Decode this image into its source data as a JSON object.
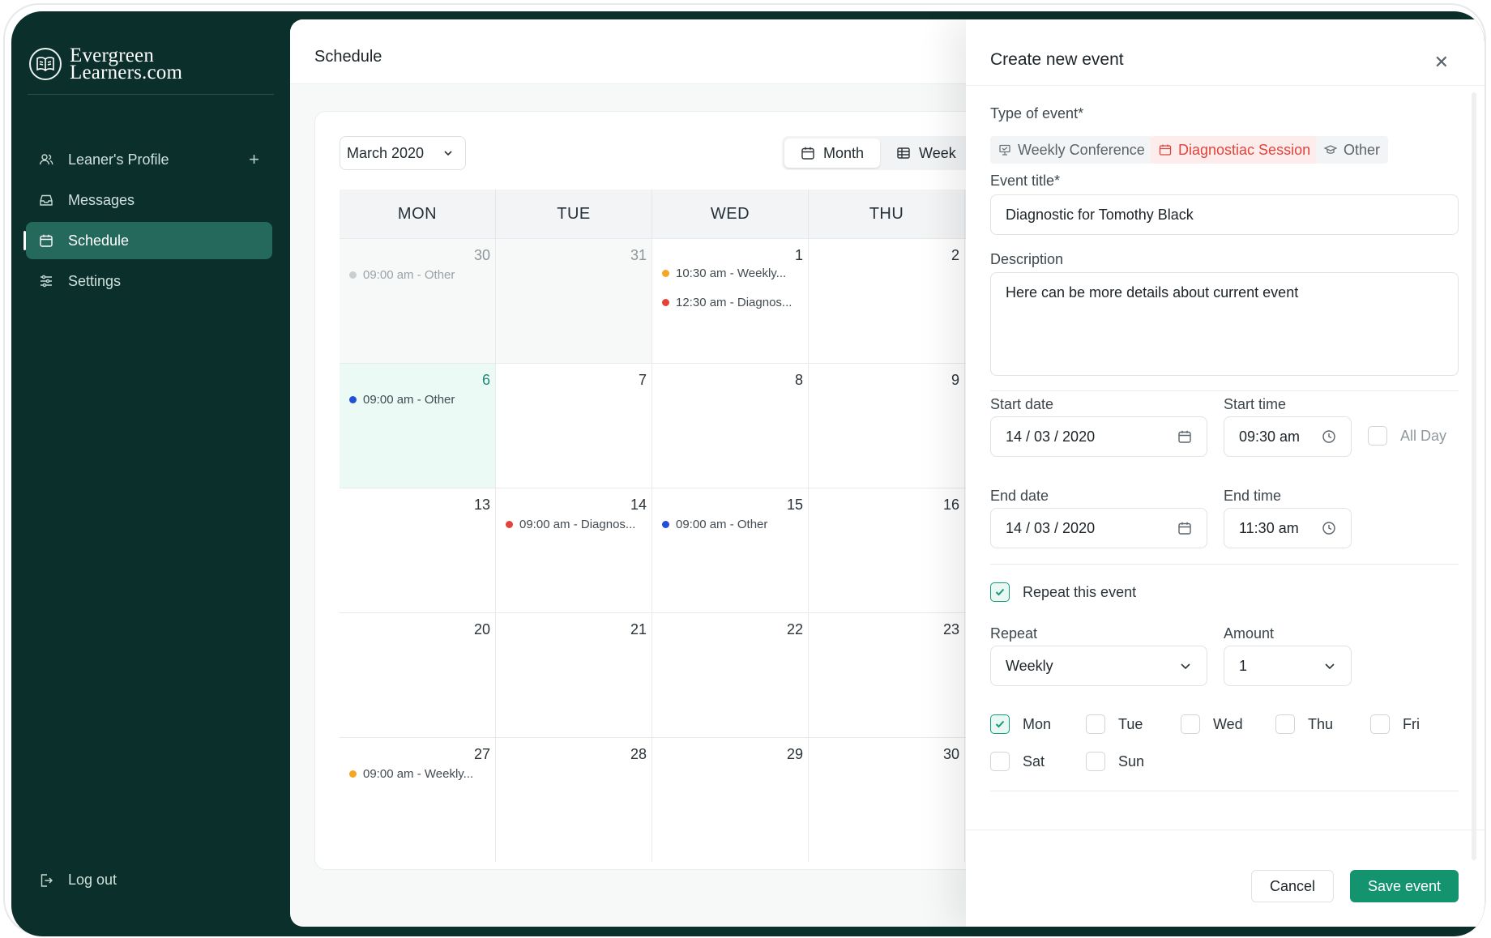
{
  "brand": {
    "line1": "Evergreen",
    "line2": "Learners.com"
  },
  "sidebar": {
    "items": [
      {
        "label": "Leaner's Profile",
        "icon": "users-icon",
        "active": false
      },
      {
        "label": "Messages",
        "icon": "inbox-icon",
        "active": false
      },
      {
        "label": "Schedule",
        "icon": "calendar-icon",
        "active": true
      },
      {
        "label": "Settings",
        "icon": "sliders-icon",
        "active": false
      }
    ],
    "plus": "+",
    "logout": "Log out"
  },
  "page": {
    "title": "Schedule"
  },
  "calendar": {
    "month_select": "March 2020",
    "views": {
      "month": "Month",
      "week": "Week"
    },
    "days": [
      "MON",
      "TUE",
      "WED",
      "THU"
    ],
    "weeks": [
      [
        "30",
        "31",
        "1",
        "2"
      ],
      [
        "6",
        "7",
        "8",
        "9"
      ],
      [
        "13",
        "14",
        "15",
        "16"
      ],
      [
        "20",
        "21",
        "22",
        "23"
      ],
      [
        "27",
        "28",
        "29",
        "30"
      ]
    ],
    "events": {
      "w0_mon": "09:00 am - Other",
      "w0_wed_a": "10:30 am - Weekly...",
      "w0_wed_b": "12:30 am - Diagnos...",
      "w1_mon": "09:00 am - Other",
      "w2_tue": "09:00 am - Diagnos...",
      "w2_wed": "09:00 am - Other",
      "w4_mon": "09:00 am - Weekly..."
    },
    "colors": {
      "weekly": "#f5a623",
      "diagnostic": "#e0443a",
      "other": "#2250d9",
      "past": "#c9ced1"
    }
  },
  "modal": {
    "title": "Create new event",
    "type_label": "Type of event*",
    "types": {
      "weekly": "Weekly Conference",
      "diagnostic": "Diagnostiac Session",
      "other": "Other"
    },
    "title_label": "Event title*",
    "title_value": "Diagnostic for Tomothy Black",
    "desc_label": "Description",
    "desc_value": "Here can be more details about current event",
    "start_date_label": "Start date",
    "start_date": "14 / 03 / 2020",
    "start_time_label": "Start time",
    "start_time": "09:30 am",
    "all_day": "All Day",
    "end_date_label": "End date",
    "end_date": "14 / 03 / 2020",
    "end_time_label": "End time",
    "end_time": "11:30 am",
    "repeat_check": "Repeat this event",
    "repeat_label": "Repeat",
    "repeat_value": "Weekly",
    "amount_label": "Amount",
    "amount_value": "1",
    "weekdays": {
      "mon": "Mon",
      "tue": "Tue",
      "wed": "Wed",
      "thu": "Thu",
      "fri": "Fri",
      "sat": "Sat",
      "sun": "Sun"
    },
    "cancel": "Cancel",
    "save": "Save event"
  }
}
